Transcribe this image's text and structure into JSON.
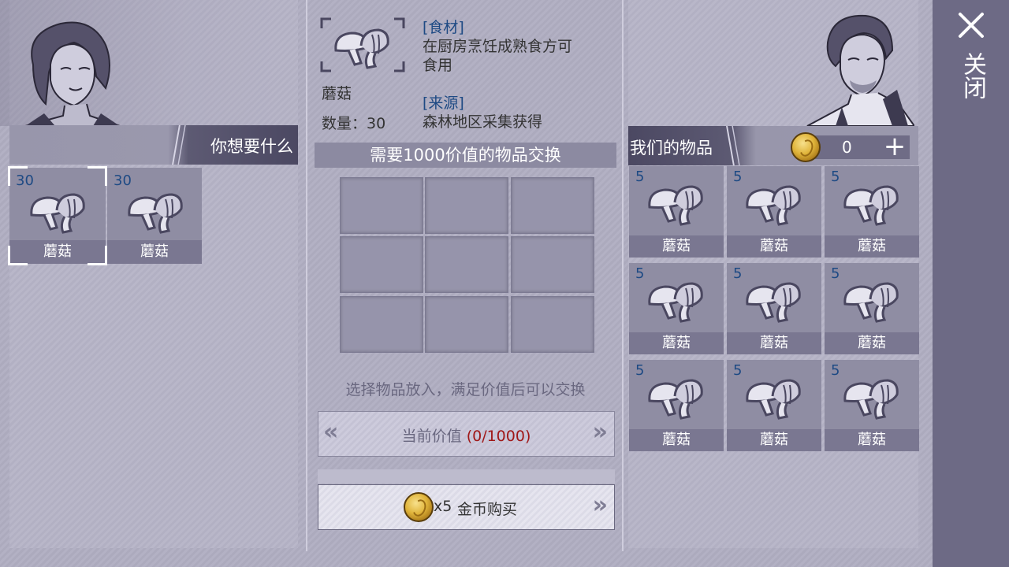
{
  "left": {
    "header_title": "你想要什么",
    "items": [
      {
        "count": "30",
        "label": "蘑菇",
        "selected": true
      },
      {
        "count": "30",
        "label": "蘑菇",
        "selected": false
      }
    ]
  },
  "detail": {
    "item_name": "蘑菇",
    "quantity_label": "数量：30",
    "category_tag": "[食材]",
    "category_desc_line1": "在厨房烹饪成熟食方可",
    "category_desc_line2": "食用",
    "source_tag": "[来源]",
    "source_desc": "森林地区采集获得"
  },
  "exchange": {
    "title": "需要1000价值的物品交换",
    "hint": "选择物品放入，满足价值后可以交换",
    "value_label": "当前价值",
    "value_text": "(0/1000)",
    "value_color": "#a01818",
    "buy_count": "x5",
    "buy_label": "金币购买"
  },
  "right": {
    "header_title": "我们的物品",
    "gold": "0",
    "items": [
      {
        "count": "5",
        "label": "蘑菇"
      },
      {
        "count": "5",
        "label": "蘑菇"
      },
      {
        "count": "5",
        "label": "蘑菇"
      },
      {
        "count": "5",
        "label": "蘑菇"
      },
      {
        "count": "5",
        "label": "蘑菇"
      },
      {
        "count": "5",
        "label": "蘑菇"
      },
      {
        "count": "5",
        "label": "蘑菇"
      },
      {
        "count": "5",
        "label": "蘑菇"
      },
      {
        "count": "5",
        "label": "蘑菇"
      }
    ]
  },
  "close_label": "关闭",
  "icons": {
    "item": "mushroom-icon",
    "currency": "gold-coin-icon",
    "close": "close-icon",
    "add": "plus-icon",
    "prev": "double-chevron-left-icon",
    "next": "double-chevron-right-icon"
  }
}
